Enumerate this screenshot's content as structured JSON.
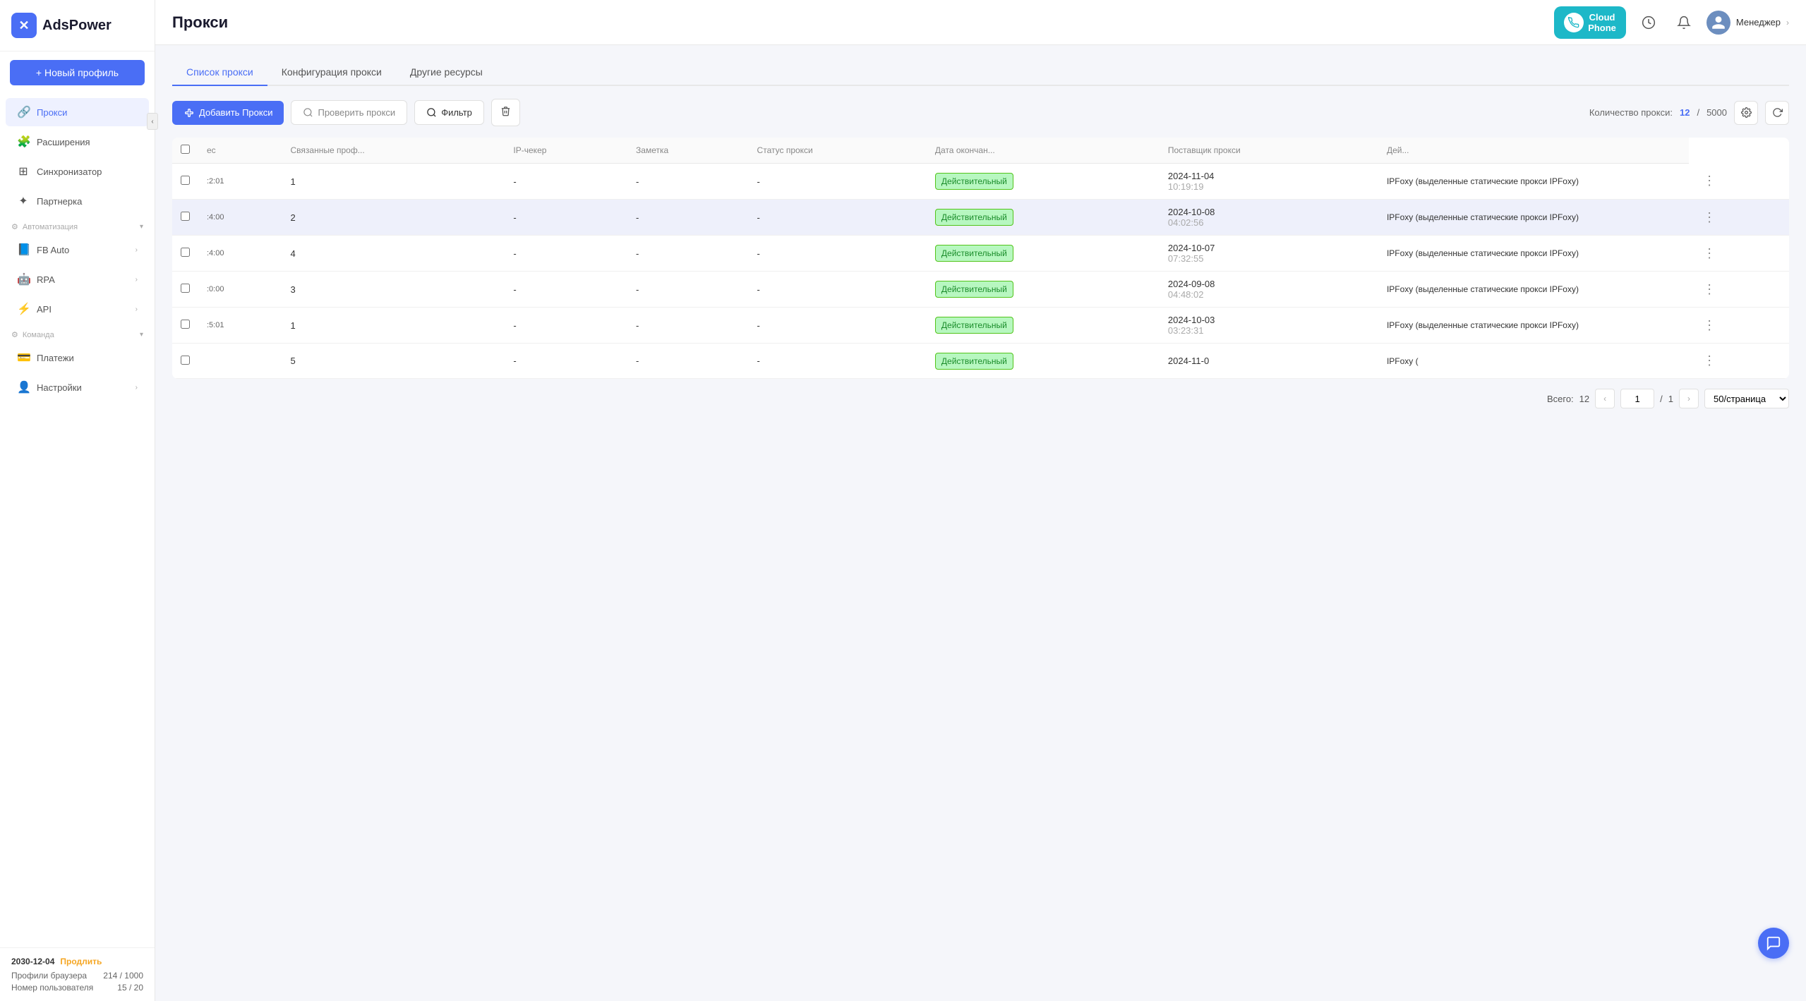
{
  "sidebar": {
    "logo_text": "AdsPower",
    "new_profile_btn": "+ Новый профиль",
    "collapse_icon": "‹",
    "nav_items": [
      {
        "id": "proxies",
        "label": "Прокси",
        "icon": "🔗",
        "active": true
      },
      {
        "id": "extensions",
        "label": "Расширения",
        "icon": "🧩",
        "active": false
      },
      {
        "id": "sync",
        "label": "Синхронизатор",
        "icon": "⊞",
        "active": false
      },
      {
        "id": "partner",
        "label": "Партнерка",
        "icon": "✦",
        "active": false
      }
    ],
    "automation_label": "Автоматизация",
    "automation_items": [
      {
        "id": "fb-auto",
        "label": "FB Auto",
        "has_arrow": true
      },
      {
        "id": "rpa",
        "label": "RPA",
        "has_arrow": true
      },
      {
        "id": "api",
        "label": "API",
        "has_arrow": true
      }
    ],
    "team_label": "Команда",
    "team_items": [
      {
        "id": "payments",
        "label": "Платежи",
        "has_arrow": false
      },
      {
        "id": "settings",
        "label": "Настройки",
        "has_arrow": true
      }
    ],
    "footer": {
      "date": "2030-12-04",
      "renew_label": "Продлить",
      "stats": [
        {
          "label": "Профили браузера",
          "value": "214 / 1000"
        },
        {
          "label": "Номер пользователя",
          "value": "15 / 20"
        }
      ]
    }
  },
  "header": {
    "title": "Прокси",
    "cloud_phone_label": "Cloud\nPhone",
    "user_name": "Менеджер"
  },
  "tabs": [
    {
      "id": "proxy-list",
      "label": "Список прокси",
      "active": true
    },
    {
      "id": "proxy-config",
      "label": "Конфигурация прокси",
      "active": false
    },
    {
      "id": "other-resources",
      "label": "Другие ресурсы",
      "active": false
    }
  ],
  "toolbar": {
    "add_proxy_label": "Добавить Прокси",
    "check_proxy_label": "Проверить прокси",
    "filter_label": "Фильтр",
    "proxy_count_text": "Количество прокси:",
    "proxy_count_value": "12",
    "proxy_count_max": "5000"
  },
  "table": {
    "columns": [
      "",
      "ес",
      "Связанные проф...",
      "IP-чекер",
      "Заметка",
      "Статус прокси",
      "Дата окончан...",
      "Поставщик прокси",
      "Дей..."
    ],
    "rows": [
      {
        "id": 1,
        "address_suffix": ":2:01",
        "order": "1",
        "linked_profiles": "-",
        "ip_checker": "-",
        "note": "-",
        "status": "Действительный",
        "expiry_date": "2024-11-04",
        "expiry_time": "10:19:19",
        "provider": "IPFoxy (выделенные статические прокси IPFoxy)",
        "highlighted": false
      },
      {
        "id": 2,
        "address_suffix": ":4:00",
        "order": "2",
        "linked_profiles": "-",
        "ip_checker": "-",
        "note": "-",
        "status": "Действительный",
        "expiry_date": "2024-10-08",
        "expiry_time": "04:02:56",
        "provider": "IPFoxy (выделенные статические прокси IPFoxy)",
        "highlighted": true
      },
      {
        "id": 3,
        "address_suffix": ":4:00",
        "order": "4",
        "linked_profiles": "-",
        "ip_checker": "-",
        "note": "-",
        "status": "Действительный",
        "expiry_date": "2024-10-07",
        "expiry_time": "07:32:55",
        "provider": "IPFoxy (выделенные статические прокси IPFoxy)",
        "highlighted": false
      },
      {
        "id": 4,
        "address_suffix": ":0:00",
        "order": "3",
        "linked_profiles": "-",
        "ip_checker": "-",
        "note": "-",
        "status": "Действительный",
        "expiry_date": "2024-09-08",
        "expiry_time": "04:48:02",
        "provider": "IPFoxy (выделенные статические прокси IPFoxy)",
        "highlighted": false
      },
      {
        "id": 5,
        "address_suffix": ":5:01",
        "order": "1",
        "linked_profiles": "-",
        "ip_checker": "-",
        "note": "-",
        "status": "Действительный",
        "expiry_date": "2024-10-03",
        "expiry_time": "03:23:31",
        "provider": "IPFoxy (выделенные статические прокси IPFoxy)",
        "highlighted": false
      },
      {
        "id": 6,
        "address_suffix": "",
        "order": "5",
        "linked_profiles": "-",
        "ip_checker": "-",
        "note": "-",
        "status": "Действительный",
        "expiry_date": "2024-11-0",
        "expiry_time": "",
        "provider": "IPFoxy (",
        "highlighted": false
      }
    ]
  },
  "pagination": {
    "total_label": "Всего:",
    "total_count": "12",
    "current_page": "1",
    "total_pages": "1",
    "per_page": "50/страница"
  }
}
